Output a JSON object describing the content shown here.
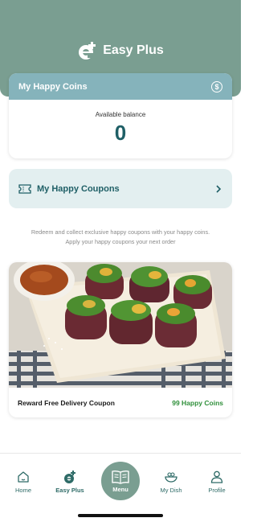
{
  "header": {
    "title": "Easy Plus",
    "bg_color": "#7a9e91"
  },
  "coins": {
    "title": "My Happy Coins",
    "balance_label": "Available balance",
    "balance_value": "0",
    "head_color": "#85b3bb",
    "value_color": "#1f5f66"
  },
  "coupons": {
    "label": "My Happy Coupons"
  },
  "info": {
    "line1": "Redeem and collect exclusive happy coupons with your happy coins.",
    "line2": "Apply your happy coupons your next order"
  },
  "reward": {
    "title": "Reward Free Delivery Coupon",
    "cost": "99 Happy Coins",
    "cost_color": "#2f8f3a"
  },
  "nav": {
    "items": [
      {
        "label": "Home",
        "icon": "home-icon"
      },
      {
        "label": "Easy Plus",
        "icon": "easy-plus-icon"
      },
      {
        "label": "Menu",
        "icon": "menu-book-icon"
      },
      {
        "label": "My Dish",
        "icon": "dish-icon"
      },
      {
        "label": "Profile",
        "icon": "profile-icon"
      }
    ]
  }
}
